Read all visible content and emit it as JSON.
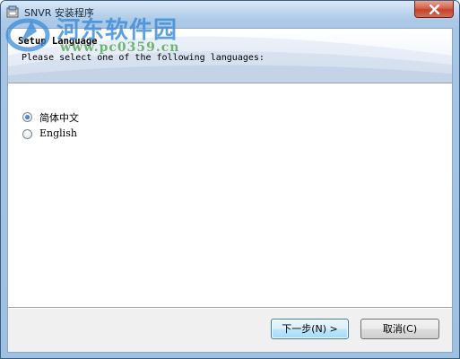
{
  "window": {
    "title": "SNVR 安装程序",
    "close_icon": "close-icon"
  },
  "watermark": {
    "text": "河东软件园",
    "url": "www.pc0359.cn"
  },
  "header": {
    "title": "Setup Language",
    "subtitle": "Please select one of the following languages:"
  },
  "languages": [
    {
      "label": "简体中文",
      "selected": true
    },
    {
      "label": "English",
      "selected": false
    }
  ],
  "buttons": {
    "next_label": "下一步(N) >",
    "cancel_label": "取消(C)"
  },
  "colors": {
    "accent": "#3c7fb1",
    "titlebar": "#bcd5ee",
    "close": "#c2432c"
  }
}
